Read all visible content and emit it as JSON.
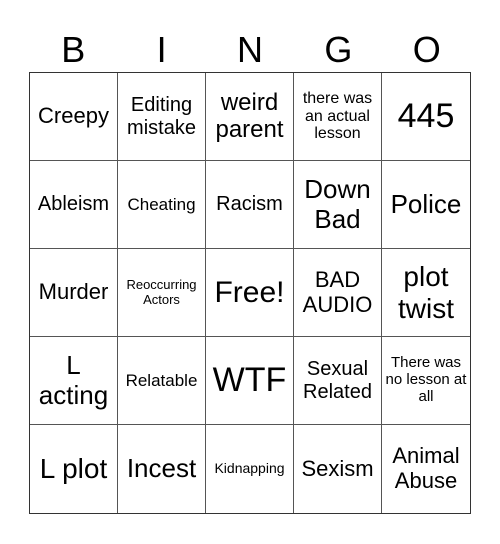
{
  "header": {
    "letters": [
      "B",
      "I",
      "N",
      "G",
      "O"
    ]
  },
  "cells": [
    {
      "text": "Creepy",
      "size": 22
    },
    {
      "text": "Editing mistake",
      "size": 20
    },
    {
      "text": "weird parent",
      "size": 24
    },
    {
      "text": "there was an actual lesson",
      "size": 16
    },
    {
      "text": "445",
      "size": 34
    },
    {
      "text": "Ableism",
      "size": 20
    },
    {
      "text": "Cheating",
      "size": 17
    },
    {
      "text": "Racism",
      "size": 20
    },
    {
      "text": "Down Bad",
      "size": 26
    },
    {
      "text": "Police",
      "size": 26
    },
    {
      "text": "Murder",
      "size": 22
    },
    {
      "text": "Reoccurring Actors",
      "size": 13
    },
    {
      "text": "Free!",
      "size": 30
    },
    {
      "text": "BAD AUDIO",
      "size": 22
    },
    {
      "text": "plot twist",
      "size": 28
    },
    {
      "text": "L acting",
      "size": 26
    },
    {
      "text": "Relatable",
      "size": 17
    },
    {
      "text": "WTF",
      "size": 34
    },
    {
      "text": "Sexual Related",
      "size": 20
    },
    {
      "text": "There was no lesson at all",
      "size": 15
    },
    {
      "text": "L plot",
      "size": 28
    },
    {
      "text": "Incest",
      "size": 26
    },
    {
      "text": "Kidnapping",
      "size": 14
    },
    {
      "text": "Sexism",
      "size": 22
    },
    {
      "text": "Animal Abuse",
      "size": 22
    }
  ]
}
